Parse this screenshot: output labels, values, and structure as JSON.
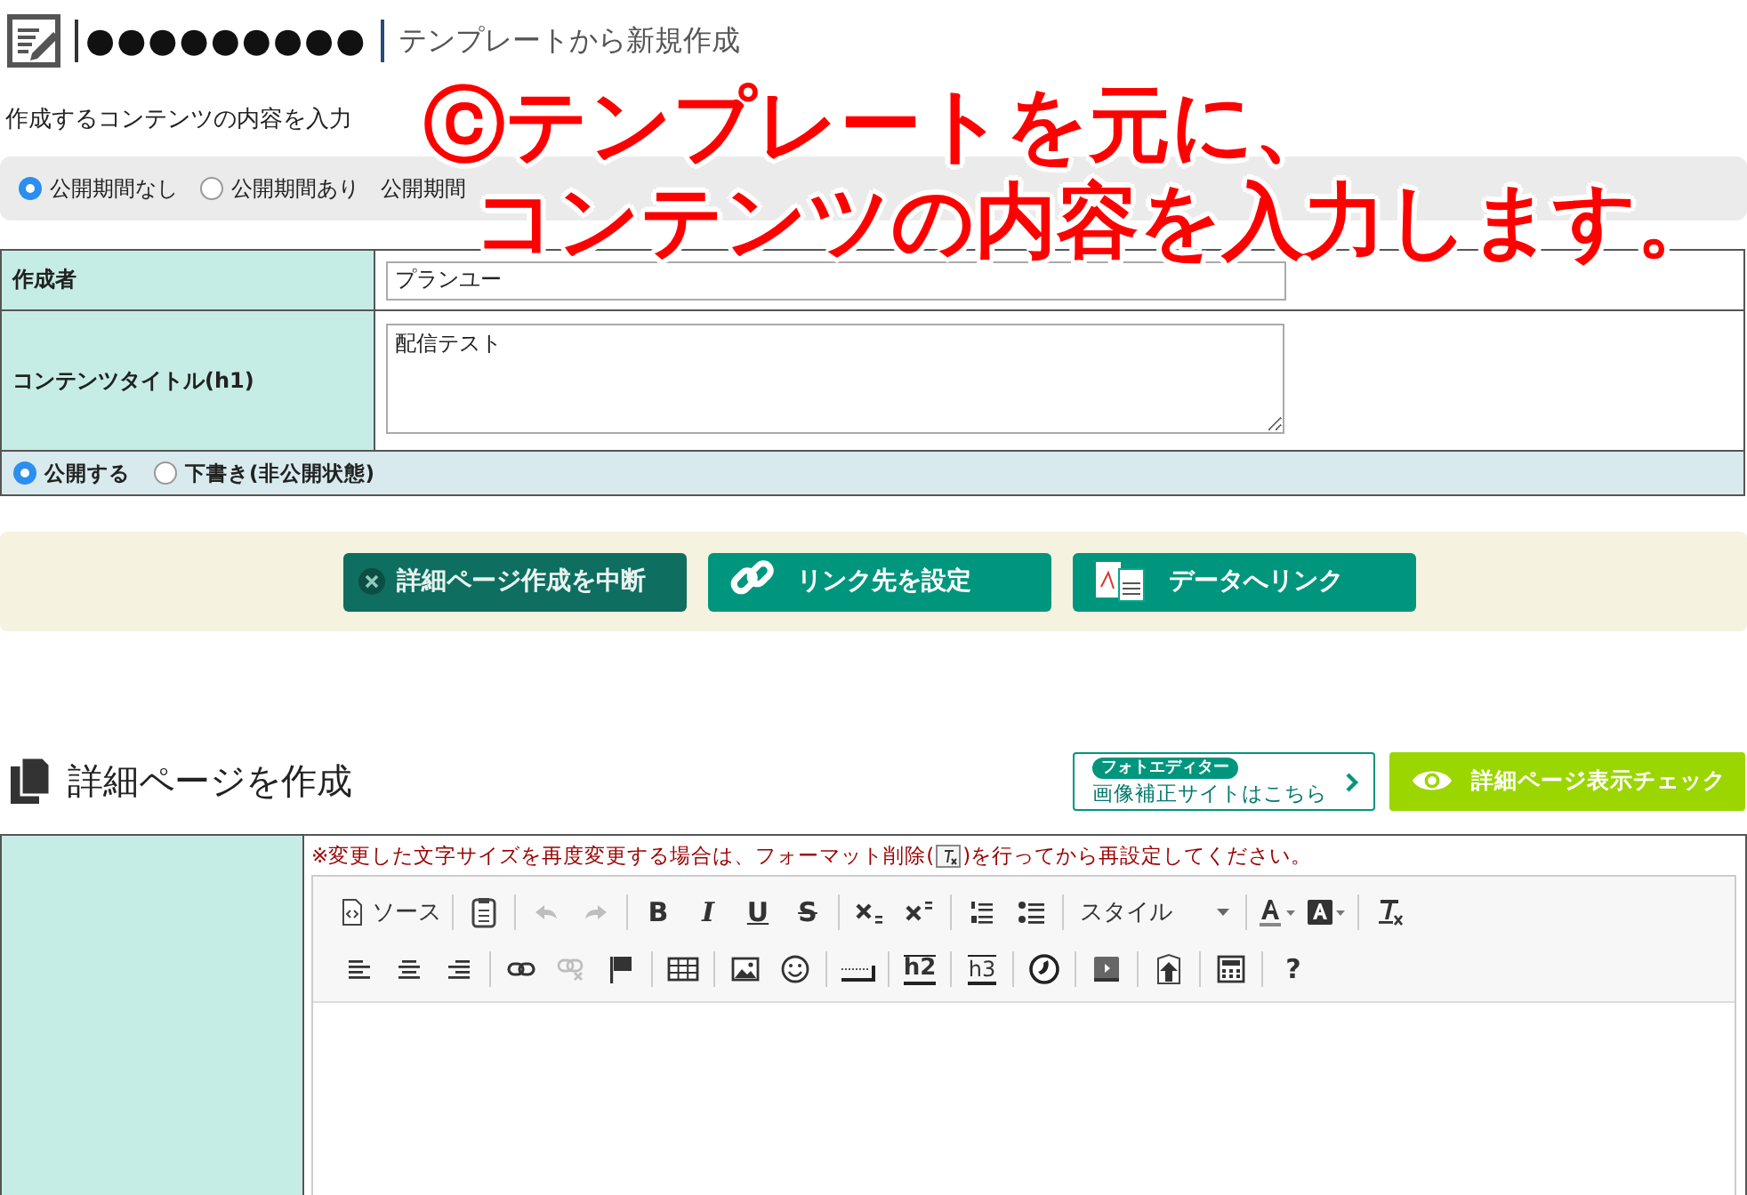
{
  "header": {
    "site_name": "●●●●●●●●●",
    "page_title": "テンプレートから新規作成"
  },
  "subtitle": "作成するコンテンツの内容を入力",
  "period": {
    "options": [
      {
        "label": "公開期間なし",
        "selected": true
      },
      {
        "label": "公開期間あり",
        "selected": false
      }
    ],
    "label": "公開期間"
  },
  "author": {
    "label": "作成者",
    "value": "プランユー"
  },
  "content_title": {
    "label": "コンテンツタイトル(h1)",
    "value": "配信テスト"
  },
  "publish": [
    {
      "label": "公開する",
      "selected": true
    },
    {
      "label": "下書き(非公開状態)",
      "selected": false
    }
  ],
  "actions": [
    {
      "kind": "cancel",
      "label": "詳細ページ作成を中断"
    },
    {
      "kind": "link",
      "label": "リンク先を設定"
    },
    {
      "kind": "data",
      "label": "データへリンク"
    }
  ],
  "section": {
    "title": "詳細ページを作成",
    "photo_editor": {
      "badge": "フォトエディター",
      "label": "画像補正サイトはこちら"
    },
    "preview_button": "詳細ページ表示チェック"
  },
  "editor": {
    "notice_before": "※変更した文字サイズを再度変更する場合は、フォーマット削除(",
    "notice_after": ")を行ってから再設定してください。",
    "toolbar_rows": [
      [
        {
          "kind": "source",
          "label": "ソース",
          "disabled": false
        },
        {
          "kind": "sep"
        },
        {
          "kind": "paste",
          "disabled": false
        },
        {
          "kind": "sep"
        },
        {
          "kind": "undo",
          "disabled": true
        },
        {
          "kind": "redo",
          "disabled": true
        },
        {
          "kind": "sep"
        },
        {
          "kind": "bold",
          "glyph": "B",
          "disabled": false
        },
        {
          "kind": "italic",
          "glyph": "I",
          "disabled": false
        },
        {
          "kind": "underline",
          "glyph": "U",
          "disabled": false
        },
        {
          "kind": "strike",
          "glyph": "S",
          "disabled": false
        },
        {
          "kind": "sep"
        },
        {
          "kind": "subscript",
          "disabled": false
        },
        {
          "kind": "superscript",
          "disabled": false
        },
        {
          "kind": "sep"
        },
        {
          "kind": "numbered-list",
          "disabled": false
        },
        {
          "kind": "bullet-list",
          "disabled": false
        },
        {
          "kind": "sep"
        },
        {
          "kind": "style",
          "label": "スタイル",
          "disabled": false
        },
        {
          "kind": "sep"
        },
        {
          "kind": "text-color",
          "disabled": false
        },
        {
          "kind": "bg-color",
          "disabled": false
        },
        {
          "kind": "sep"
        },
        {
          "kind": "remove-format",
          "disabled": false
        }
      ],
      [
        {
          "kind": "align-left",
          "disabled": false
        },
        {
          "kind": "align-center",
          "disabled": false
        },
        {
          "kind": "align-right",
          "disabled": false
        },
        {
          "kind": "sep"
        },
        {
          "kind": "link",
          "disabled": false
        },
        {
          "kind": "unlink",
          "disabled": true
        },
        {
          "kind": "flag",
          "disabled": false
        },
        {
          "kind": "sep"
        },
        {
          "kind": "table",
          "disabled": false
        },
        {
          "kind": "sep"
        },
        {
          "kind": "image",
          "disabled": false
        },
        {
          "kind": "smiley",
          "disabled": false
        },
        {
          "kind": "sep"
        },
        {
          "kind": "hr",
          "disabled": false
        },
        {
          "kind": "sep"
        },
        {
          "kind": "h2",
          "glyph": "h2",
          "disabled": false
        },
        {
          "kind": "sep"
        },
        {
          "kind": "h3",
          "glyph": "h3",
          "disabled": false
        },
        {
          "kind": "sep"
        },
        {
          "kind": "phone",
          "disabled": false
        },
        {
          "kind": "sep"
        },
        {
          "kind": "video",
          "disabled": false
        },
        {
          "kind": "sep"
        },
        {
          "kind": "upload",
          "disabled": false
        },
        {
          "kind": "sep"
        },
        {
          "kind": "template",
          "disabled": false
        },
        {
          "kind": "sep"
        },
        {
          "kind": "help",
          "glyph": "?",
          "disabled": false
        }
      ]
    ]
  },
  "annotation": {
    "lines": [
      "ⓒテンプレートを元に、",
      "コンテンツの内容を入力します。"
    ]
  }
}
